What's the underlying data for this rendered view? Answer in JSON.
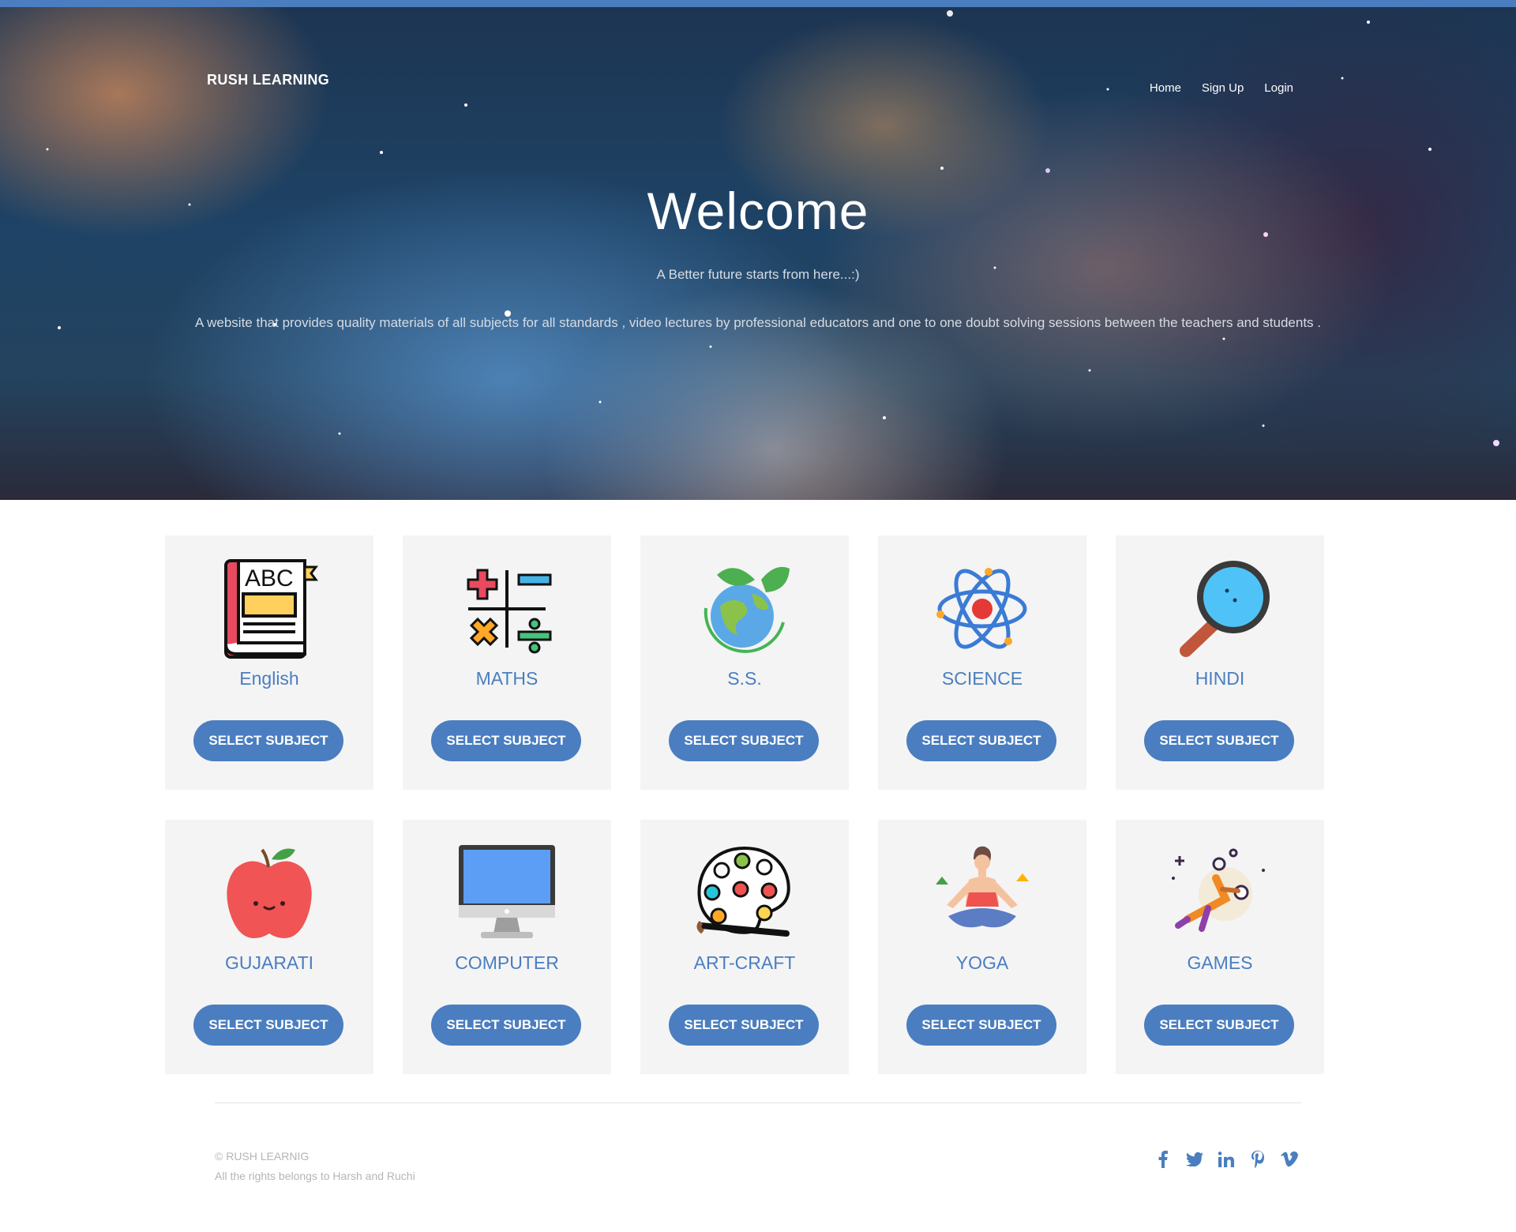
{
  "header": {
    "brand": "RUSH LEARNING",
    "nav": [
      "Home",
      "Sign Up",
      "Login"
    ]
  },
  "hero": {
    "title": "Welcome",
    "subtitle": "A Better future starts from here...:)",
    "description": "A website that provides quality materials of all subjects for all standards , video lectures by professional educators and one to one doubt solving sessions between the teachers and students ."
  },
  "subjects": [
    {
      "name": "English",
      "icon": "book-abc-icon",
      "button": "SELECT SUBJECT"
    },
    {
      "name": "MATHS",
      "icon": "math-symbols-icon",
      "button": "SELECT SUBJECT"
    },
    {
      "name": "S.S.",
      "icon": "globe-leaf-icon",
      "button": "SELECT SUBJECT"
    },
    {
      "name": "SCIENCE",
      "icon": "atom-icon",
      "button": "SELECT SUBJECT"
    },
    {
      "name": "HINDI",
      "icon": "magnifier-icon",
      "button": "SELECT SUBJECT"
    },
    {
      "name": "GUJARATI",
      "icon": "apple-icon",
      "button": "SELECT SUBJECT"
    },
    {
      "name": "COMPUTER",
      "icon": "monitor-icon",
      "button": "SELECT SUBJECT"
    },
    {
      "name": "ART-CRAFT",
      "icon": "palette-icon",
      "button": "SELECT SUBJECT"
    },
    {
      "name": "YOGA",
      "icon": "yoga-icon",
      "button": "SELECT SUBJECT"
    },
    {
      "name": "GAMES",
      "icon": "player-icon",
      "button": "SELECT SUBJECT"
    }
  ],
  "footer": {
    "copyright": "© RUSH LEARNIG",
    "rights": "All the rights belongs to Harsh and Ruchi",
    "social": [
      "facebook-icon",
      "twitter-icon",
      "linkedin-icon",
      "pinterest-icon",
      "vimeo-icon"
    ]
  },
  "colors": {
    "accent": "#4a7ec0",
    "card_bg": "#f4f4f4"
  }
}
